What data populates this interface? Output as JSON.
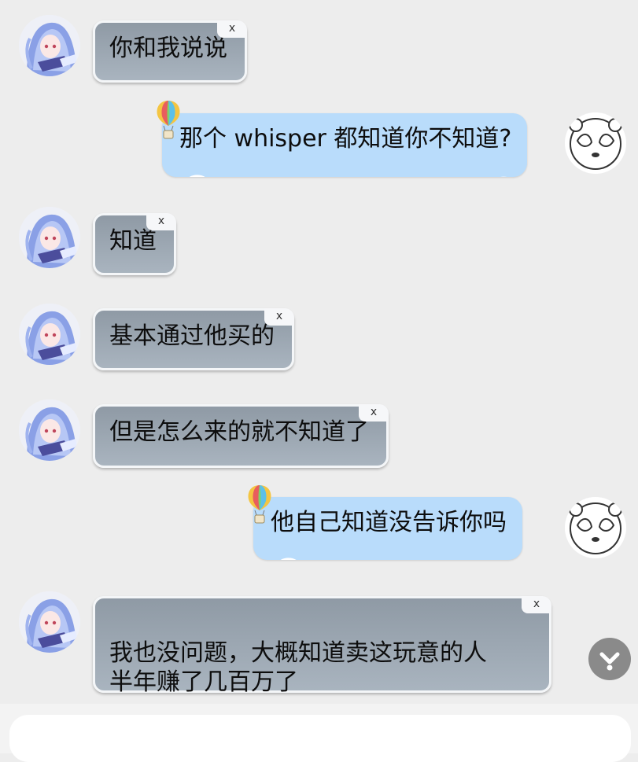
{
  "close_label": "x",
  "messages": [
    {
      "side": "left",
      "text": "你和我说说"
    },
    {
      "side": "right",
      "text": "那个 whisper 都知道你不知道?"
    },
    {
      "side": "left",
      "text": "知道"
    },
    {
      "side": "left",
      "text": "基本通过他买的"
    },
    {
      "side": "left",
      "text": "但是怎么来的就不知道了"
    },
    {
      "side": "right",
      "text": "他自己知道没告诉你吗"
    },
    {
      "side": "left",
      "text": "我也没问题，大概知道卖这玩意的人\n半年赚了几百万了"
    }
  ],
  "icons": {
    "left_avatar": "anime-girl-avatar",
    "right_avatar": "sketch-bear-avatar",
    "bubble_decoration": "hot-air-balloon-icon",
    "scroll_down": "chevron-down-icon"
  },
  "colors": {
    "background": "#ededed",
    "left_bubble": "#9aa5b0",
    "right_bubble": "#b9dcfb",
    "scroll_button": "#8a8a8a"
  }
}
